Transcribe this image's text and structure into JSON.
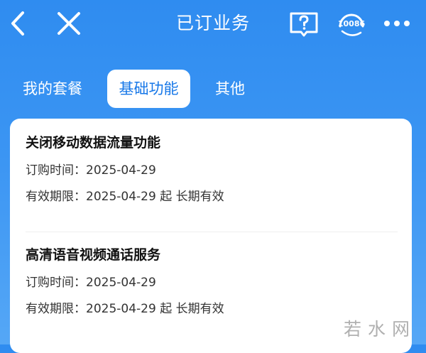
{
  "header": {
    "title": "已订业务",
    "service_number": "10086",
    "icons": {
      "back": "chevron-left-icon",
      "close": "close-icon",
      "help": "help-book-icon",
      "service": "headset-icon",
      "more": "more-dots-icon"
    }
  },
  "tabs": [
    {
      "label": "我的套餐",
      "active": false
    },
    {
      "label": "基础功能",
      "active": true
    },
    {
      "label": "其他",
      "active": false
    }
  ],
  "services": [
    {
      "name": "关闭移动数据流量功能",
      "order_time": "订购时间：2025-04-29",
      "validity": "有效期限：2025-04-29 起 长期有效"
    },
    {
      "name": "高清语音视频通话服务",
      "order_time": "订购时间：2025-04-29",
      "validity": "有效期限：2025-04-29 起 长期有效"
    }
  ],
  "watermark": "若水网",
  "colors": {
    "background_top": "#2f8cf0",
    "background_bottom": "#55a7f6",
    "active_tab_text": "#1677e8",
    "card": "#ffffff"
  }
}
